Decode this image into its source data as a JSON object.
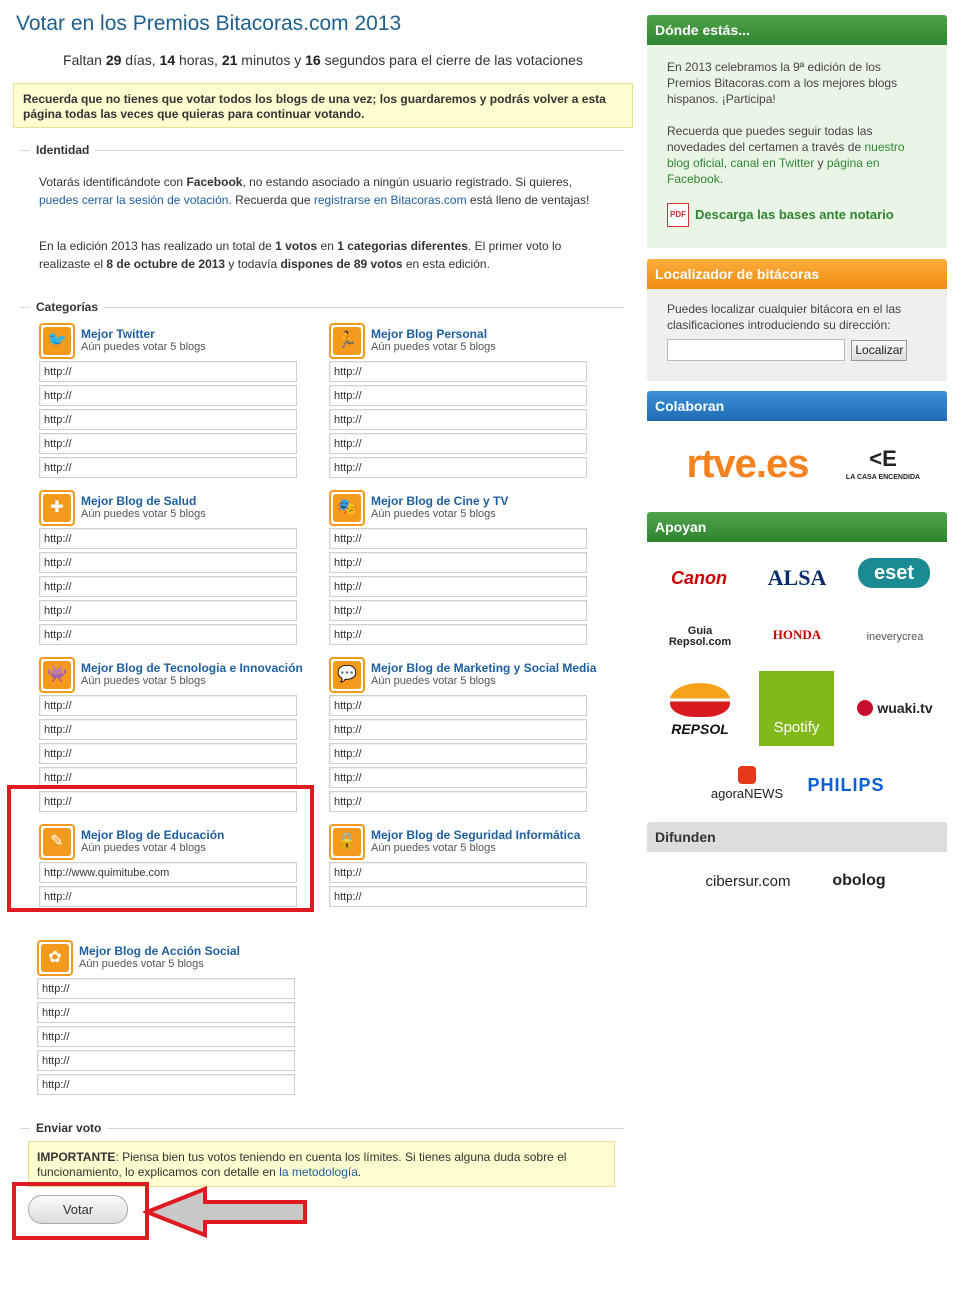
{
  "header": {
    "title": "Votar en los Premios Bitacoras.com 2013",
    "countdown": {
      "prefix": "Faltan ",
      "days": "29",
      "days_label": " días, ",
      "hours": "14",
      "hours_label": " horas, ",
      "minutes": "21",
      "minutes_label": " minutos y ",
      "seconds": "16",
      "seconds_label": " segundos para el cierre de las votaciones"
    },
    "notice": "Recuerda que no tienes que votar todos los blogs de una vez; los guardaremos y podrás volver a esta página todas las veces que quieras para continuar votando."
  },
  "identity": {
    "legend": "Identidad",
    "p1_a": "Votarás identificándote con ",
    "p1_fb": "Facebook",
    "p1_b": ", no estando asociado a ningún usuario registrado. Si quieres, ",
    "p1_link1": "puedes cerrar la sesión de votación",
    "p1_c": ". Recuerda que ",
    "p1_link2": "registrarse en Bitacoras.com",
    "p1_d": " está lleno de ventajas!",
    "p2_a": "En la edición 2013 has realizado un total de ",
    "p2_votes": "1 votos",
    "p2_b": " en ",
    "p2_cats": "1 categorias diferentes",
    "p2_c": ". El primer voto lo realizaste el ",
    "p2_date": "8 de octubre de 2013",
    "p2_d": " y todavía ",
    "p2_remaining": "dispones de 89 votos",
    "p2_e": " en esta edición."
  },
  "categories": {
    "legend": "Categorías",
    "items": [
      {
        "title": "Mejor Twitter",
        "subtitle": "Aún puedes votar 5 blogs",
        "icon": "twitter-bird-icon",
        "glyph": "🐦",
        "inputs": [
          "http://",
          "http://",
          "http://",
          "http://",
          "http://"
        ]
      },
      {
        "title": "Mejor Blog Personal",
        "subtitle": "Aún puedes votar 5 blogs",
        "icon": "person-running-icon",
        "glyph": "🏃",
        "inputs": [
          "http://",
          "http://",
          "http://",
          "http://",
          "http://"
        ]
      },
      {
        "title": "Mejor Blog de Salud",
        "subtitle": "Aún puedes votar 5 blogs",
        "icon": "first-aid-kit-icon",
        "glyph": "✚",
        "inputs": [
          "http://",
          "http://",
          "http://",
          "http://",
          "http://"
        ]
      },
      {
        "title": "Mejor Blog de Cine y TV",
        "subtitle": "Aún puedes votar 5 blogs",
        "icon": "theatre-masks-icon",
        "glyph": "🎭",
        "inputs": [
          "http://",
          "http://",
          "http://",
          "http://",
          "http://"
        ]
      },
      {
        "title": "Mejor Blog de Tecnologia e Innovación",
        "subtitle": "Aún puedes votar 5 blogs",
        "icon": "space-invader-icon",
        "glyph": "👾",
        "inputs": [
          "http://",
          "http://",
          "http://",
          "http://",
          "http://"
        ]
      },
      {
        "title": "Mejor Blog de Marketing y Social Media",
        "subtitle": "Aún puedes votar 5 blogs",
        "icon": "speech-bubble-icon",
        "glyph": "💬",
        "inputs": [
          "http://",
          "http://",
          "http://",
          "http://",
          "http://"
        ]
      },
      {
        "title": "Mejor Blog de Educación",
        "subtitle": "Aún puedes votar 4 blogs",
        "icon": "pencil-icon",
        "glyph": "✎",
        "inputs": [
          "http://www.quimitube.com",
          "http://"
        ]
      },
      {
        "title": "Mejor Blog de Seguridad Informática",
        "subtitle": "Aún puedes votar 5 blogs",
        "icon": "padlock-icon",
        "glyph": "🔒",
        "inputs": [
          "http://",
          "http://"
        ]
      },
      {
        "title": "Mejor Blog de Acción Social",
        "subtitle": "Aún puedes votar 5 blogs",
        "icon": "flower-icon",
        "glyph": "✿",
        "inputs": [
          "http://",
          "http://",
          "http://",
          "http://",
          "http://"
        ]
      }
    ]
  },
  "send": {
    "legend": "Enviar voto",
    "important_label": "IMPORTANTE",
    "important_text": ": Piensa bien tus votos teniendo en cuenta los límites. Si tienes alguna duda sobre el funcionamiento, lo explicamos con detalle en ",
    "important_link": "la metodología",
    "important_end": ".",
    "vote_button": "Votar"
  },
  "sidebar": {
    "where": {
      "heading": "Dónde estás...",
      "p1": "En 2013 celebramos la 9ª edición de los Premios Bitacoras.com a los mejores blogs hispanos. ¡Participa!",
      "p2_a": "Recuerda que puedes seguir todas las novedades del certamen a través de ",
      "p2_link1": "nuestro blog oficial",
      "p2_sep1": ", ",
      "p2_link2": "canal en Twitter",
      "p2_sep2": " y ",
      "p2_link3": "página en Facebook",
      "p2_end": ".",
      "pdf_label": "Descarga las bases ante notario",
      "pdf_icon_text": "PDF"
    },
    "locator": {
      "heading": "Localizador de bitácoras",
      "text": "Puedes localizar cualquier bitácora en el las clasificaciones introduciendo su dirección:",
      "input_value": "",
      "button": "Localizar"
    },
    "collaborate": {
      "heading": "Colaboran",
      "logos": [
        "rtve.es",
        "LA CASA ENCENDIDA"
      ]
    },
    "support": {
      "heading": "Apoyan",
      "logos": [
        "Canon",
        "ALSA",
        "eset",
        "Guia Repsol.com",
        "HONDA",
        "ineverycrea",
        "REPSOL",
        "Spotify",
        "wuaki.tv",
        "agoraNEWS",
        "PHILIPS"
      ]
    },
    "spread": {
      "heading": "Difunden",
      "logos": [
        "cibersur.com",
        "obolog"
      ]
    }
  },
  "colors": {
    "title_blue": "#1f5f8f",
    "link_blue": "#1f5fa0",
    "orange_accent": "#f39a1d",
    "green_head": "#2f8530",
    "annotation_red": "#e01a22"
  }
}
